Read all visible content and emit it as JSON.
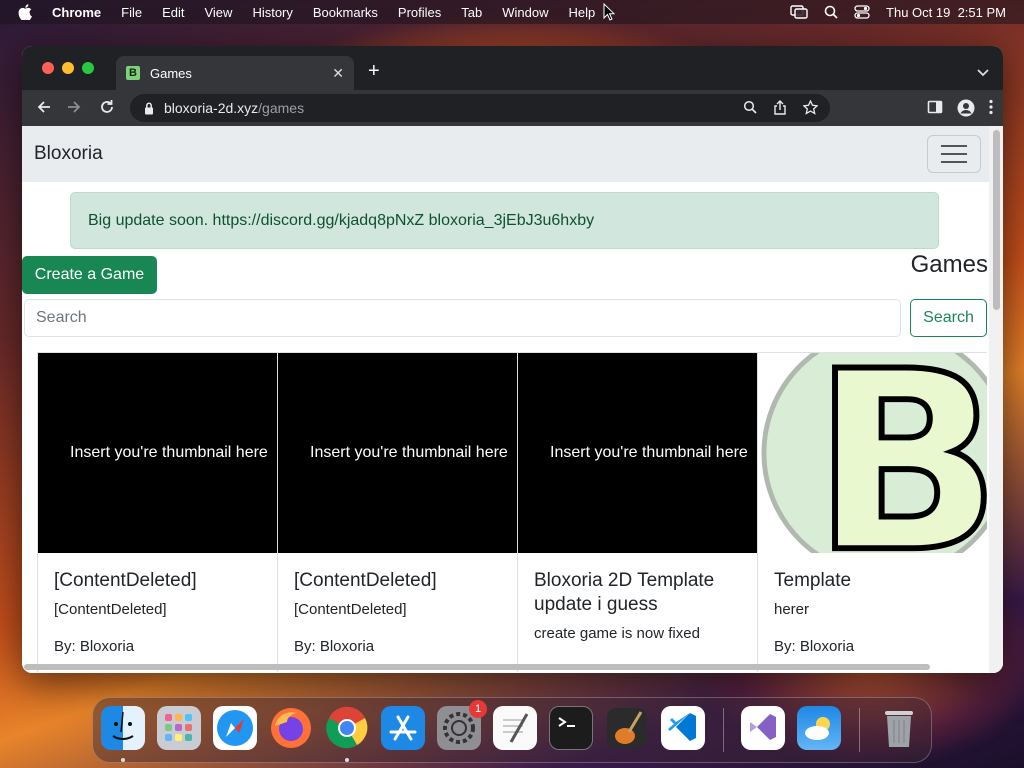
{
  "menubar": {
    "app_name": "Chrome",
    "items": [
      "File",
      "Edit",
      "View",
      "History",
      "Bookmarks",
      "Profiles",
      "Tab",
      "Window",
      "Help"
    ],
    "datetime": "Thu Oct 19  2:51 PM"
  },
  "browser": {
    "tab_title": "Games",
    "favicon_letter": "B",
    "url_host": "bloxoria-2d.xyz",
    "url_path": "/games"
  },
  "page": {
    "brand": "Bloxoria",
    "alert_text": "Big update soon. https://discord.gg/kjadq8pNxZ bloxoria_3jEbJ3u6hxby",
    "create_button": "Create a Game",
    "heading": "Games",
    "search_placeholder": "Search",
    "search_button": "Search",
    "cards": [
      {
        "thumbnail_text": "Insert you're thumbnail here",
        "title": "[ContentDeleted]",
        "text": "[ContentDeleted]",
        "author": "By: Bloxoria"
      },
      {
        "thumbnail_text": "Insert you're thumbnail here",
        "title": "[ContentDeleted]",
        "text": "[ContentDeleted]",
        "author": "By: Bloxoria"
      },
      {
        "thumbnail_text": "Insert you're thumbnail here",
        "title": "Bloxoria 2D Template update i guess",
        "text": "create game is now fixed",
        "author": ""
      },
      {
        "thumbnail_text": "B",
        "title": "Template",
        "text": "herer",
        "author": "By: Bloxoria"
      }
    ]
  },
  "dock": {
    "apps": [
      "finder-icon",
      "launchpad-icon",
      "safari-icon",
      "firefox-icon",
      "chrome-icon",
      "app-store-icon",
      "system-settings-icon",
      "textedit-icon",
      "terminal-icon",
      "garageband-icon",
      "vscode-icon",
      "visual-studio-icon",
      "weather-icon",
      "trash-icon"
    ],
    "settings_badge": "1"
  },
  "colors": {
    "success": "#198754",
    "alert_bg": "#d1e7dd",
    "navbar_bg": "#e9ecef"
  }
}
